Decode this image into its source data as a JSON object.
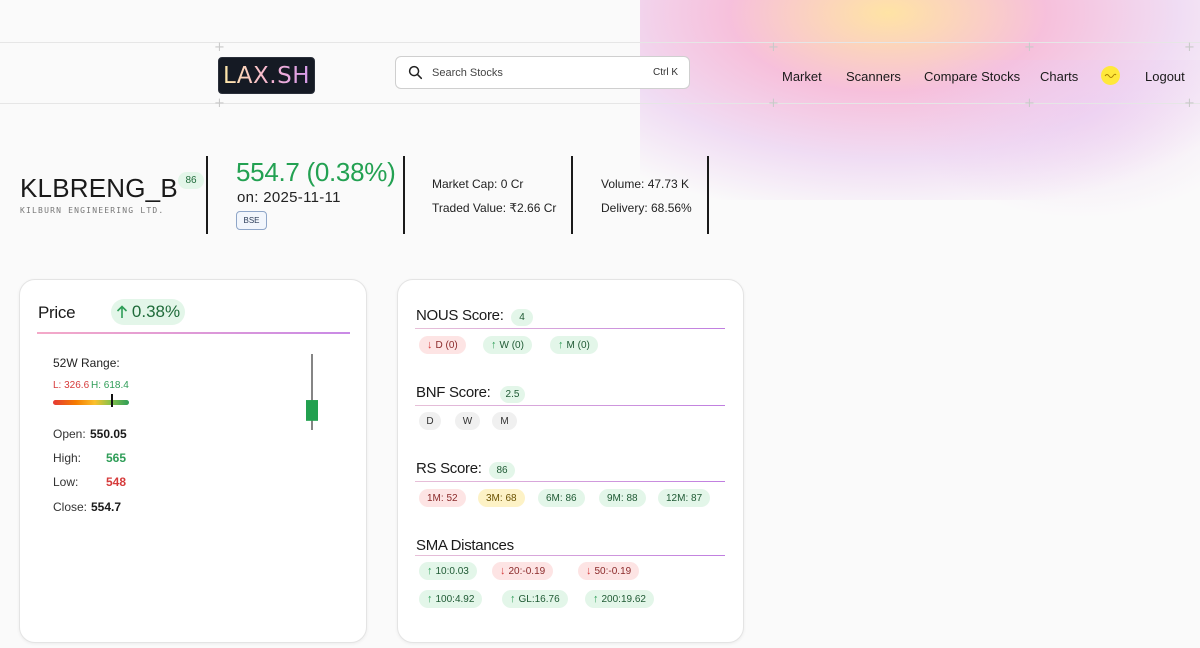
{
  "header": {
    "logo": "LAX.SH",
    "search": {
      "placeholder": "Search Stocks",
      "shortcut": "Ctrl K"
    },
    "nav": [
      "Market",
      "Scanners",
      "Compare Stocks",
      "Charts",
      "Logout"
    ],
    "avatar_label": "user avatar"
  },
  "stock": {
    "ticker": "KLBRENG_B",
    "company": "KILBURN ENGINEERING LTD.",
    "rank": "86",
    "price_change": "554.7 (0.38%)",
    "date": "on: 2025-11-11",
    "exchange": "BSE",
    "market_cap": "Market Cap: 0 Cr",
    "traded_value": "Traded Value: ₹2.66 Cr",
    "volume": "Volume: 47.73 K",
    "delivery": "Delivery: 68.56%"
  },
  "price_card": {
    "title": "Price",
    "change": "0.38%",
    "range_label": "52W Range:",
    "low": "L: 326.6",
    "high": "H: 618.4",
    "range_position": 0.78,
    "open_label": "Open:",
    "open": "550.05",
    "high_label": "High:",
    "high_val": "565",
    "low_label": "Low:",
    "low_val": "548",
    "close_label": "Close:",
    "close": "554.7",
    "candle": {
      "open": 550.05,
      "high": 565,
      "low": 548,
      "close": 554.7
    }
  },
  "score_card": {
    "nous": {
      "title": "NOUS Score:",
      "score": "4",
      "chips": [
        {
          "label": "D (0)",
          "dir": "down",
          "color": "red"
        },
        {
          "label": "W (0)",
          "dir": "up",
          "color": "green"
        },
        {
          "label": "M (0)",
          "dir": "up",
          "color": "green"
        }
      ]
    },
    "bnf": {
      "title": "BNF Score:",
      "score": "2.5",
      "chips": [
        "D",
        "W",
        "M"
      ]
    },
    "rs": {
      "title": "RS Score:",
      "score": "86",
      "chips": [
        {
          "label": "1M: 52",
          "color": "red"
        },
        {
          "label": "3M: 68",
          "color": "yellow"
        },
        {
          "label": "6M: 86",
          "color": "green"
        },
        {
          "label": "9M: 88",
          "color": "green"
        },
        {
          "label": "12M: 87",
          "color": "green"
        }
      ]
    },
    "sma": {
      "title": "SMA Distances",
      "chips": [
        {
          "label": "10:0.03",
          "dir": "up",
          "color": "green"
        },
        {
          "label": "20:-0.19",
          "dir": "down",
          "color": "red"
        },
        {
          "label": "50:-0.19",
          "dir": "down",
          "color": "red"
        },
        {
          "label": "100:4.92",
          "dir": "up",
          "color": "green"
        },
        {
          "label": "GL:16.76",
          "dir": "up",
          "color": "green"
        },
        {
          "label": "200:19.62",
          "dir": "up",
          "color": "green"
        }
      ]
    }
  }
}
